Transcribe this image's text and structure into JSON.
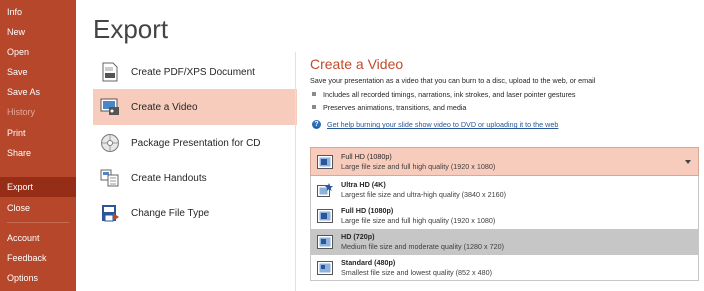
{
  "nav": {
    "items": [
      {
        "label": "Info",
        "state": "normal"
      },
      {
        "label": "New",
        "state": "normal"
      },
      {
        "label": "Open",
        "state": "normal"
      },
      {
        "label": "Save",
        "state": "normal"
      },
      {
        "label": "Save As",
        "state": "normal"
      },
      {
        "label": "History",
        "state": "disabled"
      },
      {
        "label": "Print",
        "state": "normal"
      },
      {
        "label": "Share",
        "state": "normal"
      },
      {
        "label": "Export",
        "state": "active"
      },
      {
        "label": "Close",
        "state": "normal"
      },
      {
        "label": "Account",
        "state": "normal"
      },
      {
        "label": "Feedback",
        "state": "normal"
      },
      {
        "label": "Options",
        "state": "normal"
      }
    ]
  },
  "page": {
    "title": "Export"
  },
  "options": [
    {
      "label": "Create PDF/XPS Document",
      "icon": "pdf-document-icon"
    },
    {
      "label": "Create a Video",
      "icon": "video-icon",
      "selected": true
    },
    {
      "label": "Package Presentation for CD",
      "icon": "cd-package-icon"
    },
    {
      "label": "Create Handouts",
      "icon": "handouts-icon"
    },
    {
      "label": "Change File Type",
      "icon": "change-file-type-icon"
    }
  ],
  "panel": {
    "title": "Create a Video",
    "description": "Save your presentation as a video that you can burn to a disc, upload to the web, or email",
    "bullets": [
      "Includes all recorded timings, narrations, ink strokes, and laser pointer gestures",
      "Preserves animations, transitions, and media"
    ],
    "help_link": "Get help burning your slide show video to DVD or uploading it to the web"
  },
  "quality_dropdown": {
    "selected": {
      "name": "Full HD (1080p)",
      "desc": "Large file size and full high quality (1920 x 1080)"
    },
    "options": [
      {
        "name": "Ultra HD (4K)",
        "desc": "Largest file size and ultra-high quality (3840 x 2160)"
      },
      {
        "name": "Full HD (1080p)",
        "desc": "Large file size and full high quality (1920 x 1080)"
      },
      {
        "name": "HD (720p)",
        "desc": "Medium file size and moderate quality (1280 x 720)",
        "highlighted": true
      },
      {
        "name": "Standard (480p)",
        "desc": "Smallest file size and lowest quality (852 x 480)"
      }
    ]
  },
  "colors": {
    "accent": "#b7472a",
    "active_nav": "#962e17",
    "selection": "#f8ccbd",
    "link": "#2b579a"
  }
}
